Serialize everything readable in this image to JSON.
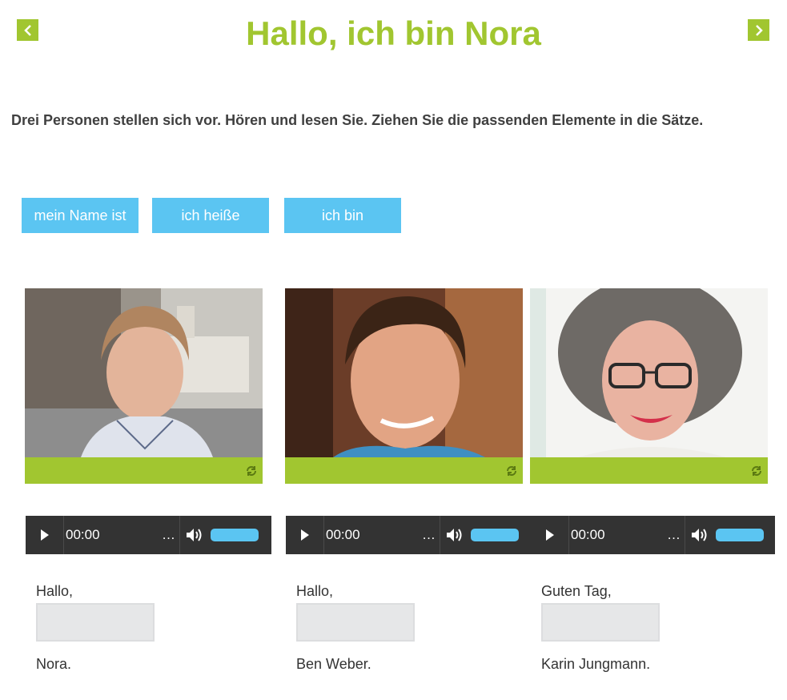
{
  "header": {
    "title": "Hallo, ich bin Nora",
    "prev_icon": "chevron-left-icon",
    "next_icon": "chevron-right-icon"
  },
  "instruction": "Drei Personen stellen sich vor. Hören und lesen Sie. Ziehen Sie die passenden Elemente in die Sätze.",
  "chips": [
    "mein Name ist",
    "ich heiße",
    "ich bin"
  ],
  "players": [
    {
      "time": "00:00",
      "more": "…"
    },
    {
      "time": "00:00",
      "more": "…"
    },
    {
      "time": "00:00",
      "more": "…"
    }
  ],
  "sentences": [
    {
      "before": "Hallo,",
      "after": "Nora."
    },
    {
      "before": "Hallo,",
      "after": "Ben Weber."
    },
    {
      "before": "Guten Tag,",
      "after": "Karin Jungmann."
    }
  ],
  "colors": {
    "accent_green": "#a1c630",
    "chip_blue": "#5bc5f2",
    "player_bg": "#333333",
    "drop_zone": "#e6e7e8"
  }
}
